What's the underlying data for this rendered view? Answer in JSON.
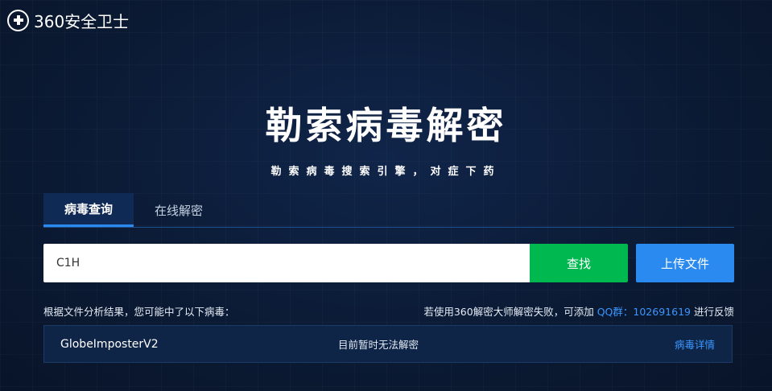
{
  "header": {
    "logo_icon": "plus-circle-icon",
    "brand": "360安全卫士"
  },
  "hero": {
    "title": "勒索病毒解密",
    "subtitle": "勒索病毒搜索引擎，对症下药"
  },
  "tabs": [
    {
      "label": "病毒查询",
      "active": true
    },
    {
      "label": "在线解密",
      "active": false
    }
  ],
  "search": {
    "value": "C1H",
    "button_label": "查找",
    "upload_label": "上传文件"
  },
  "results": {
    "summary": "根据文件分析结果，您可能中了以下病毒：",
    "feedback_prefix": "若使用360解密大师解密失败，可添加",
    "feedback_qq": "QQ群：102691619",
    "feedback_suffix": "进行反馈",
    "rows": [
      {
        "name": "GlobeImposterV2",
        "status": "目前暂时无法解密",
        "link": "病毒详情"
      }
    ]
  },
  "colors": {
    "background": "#0b1a33",
    "accent_blue": "#2b8af0",
    "search_green": "#00b850",
    "link_blue": "#3a96ff"
  }
}
